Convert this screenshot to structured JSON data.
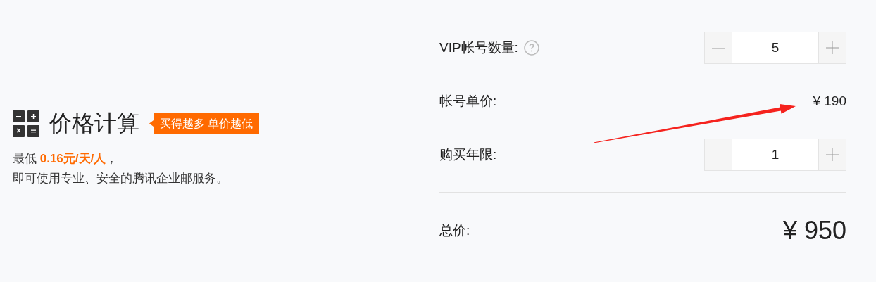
{
  "intro": {
    "title": "价格计算",
    "badge": "买得越多 单价越低",
    "description": [
      "最低 **0.16元/天/人**，",
      "即可使用专业、安全的腾讯企业邮服务。"
    ]
  },
  "rows": [
    {
      "kind": "stepper",
      "label": "VIP帐号数量:",
      "help": true,
      "value": "5"
    },
    {
      "kind": "price",
      "label": "帐号单价:",
      "value": "¥ 190"
    },
    {
      "kind": "stepper",
      "label": "购买年限:",
      "help": false,
      "value": "1"
    }
  ],
  "total": {
    "label": "总价:",
    "value": "¥ 950"
  }
}
